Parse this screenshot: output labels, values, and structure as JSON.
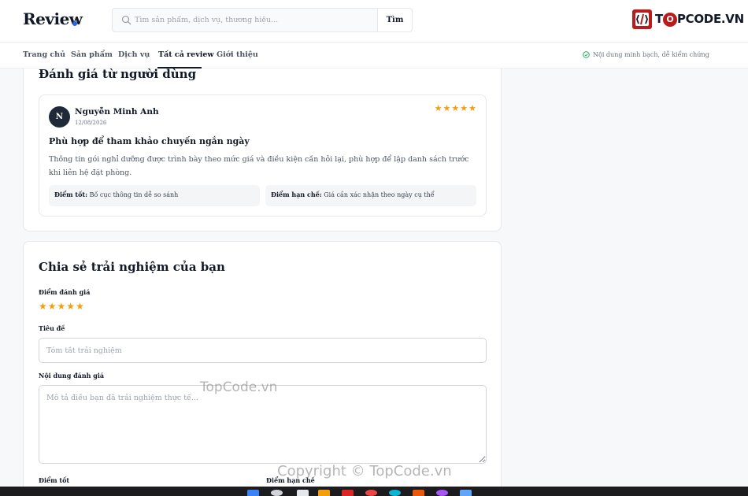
{
  "header": {
    "logo": "Review",
    "search": {
      "placeholder": "Tìm sản phẩm, dịch vụ, thương hiệu...",
      "button_label": "Tìm"
    },
    "brand": {
      "prefix": "T",
      "o": "O",
      "suffix": "PCODE.VN"
    }
  },
  "nav": {
    "items": [
      {
        "label": "Trang chủ"
      },
      {
        "label": "Sản phẩm"
      },
      {
        "label": "Dịch vụ"
      },
      {
        "label": "Tất cả review",
        "active": true
      },
      {
        "label": "Giới thiệu"
      }
    ],
    "trust_text": "Nội dung minh bạch, dễ kiểm chứng"
  },
  "reviews_section": {
    "title": "Đánh giá từ người dùng",
    "reviews": [
      {
        "avatar_initial": "N",
        "name": "Nguyễn Minh Anh",
        "date": "12/08/2026",
        "rating": 5,
        "title": "Phù hợp để tham khảo chuyến ngắn ngày",
        "body": "Thông tin gói nghỉ dưỡng được trình bày theo mức giá và điều kiện cần hỏi lại, phù hợp để lập danh sách trước khi liên hệ đặt phòng.",
        "pros_label": "Điểm tốt:",
        "pros": "Bố cục thông tin dễ so sánh",
        "cons_label": "Điểm hạn chế:",
        "cons": "Giá cần xác nhận theo ngày cụ thể"
      }
    ]
  },
  "form": {
    "title": "Chia sẻ trải nghiệm của bạn",
    "rating_label": "Điểm đánh giá",
    "rating": 5,
    "title_label": "Tiêu đề",
    "title_placeholder": "Tóm tắt trải nghiệm",
    "content_label": "Nội dung đánh giá",
    "content_placeholder": "Mô tả điều bạn đã trải nghiệm thực tế...",
    "pros_label": "Điểm tốt",
    "cons_label": "Điểm hạn chế"
  },
  "watermarks": {
    "small": "TopCode.vn",
    "large": "Copyright © TopCode.vn"
  },
  "icons": [
    "search-icon",
    "check-circle-icon",
    "brand-logo-icon",
    "star-icon"
  ],
  "colors": {
    "accent": "#2563eb",
    "star": "#f59e0b",
    "brand_red": "#b91c1c",
    "dark": "#1f2937"
  }
}
